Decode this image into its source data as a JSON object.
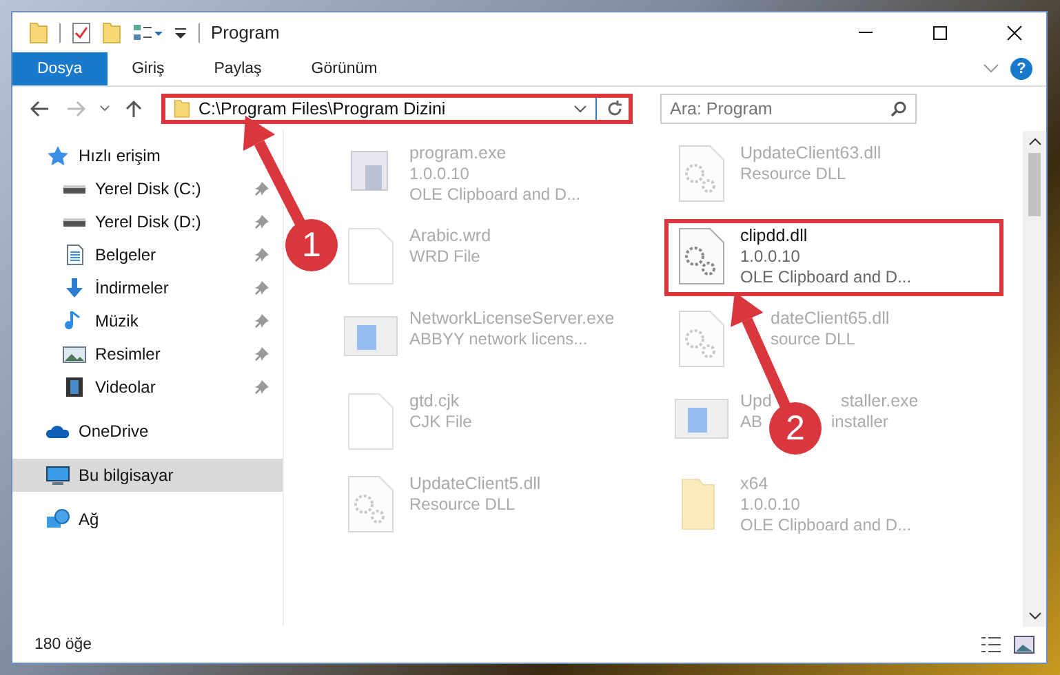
{
  "window": {
    "title": "Program"
  },
  "ribbon": {
    "tabs": [
      {
        "label": "Dosya",
        "selected": true
      },
      {
        "label": "Giriş",
        "selected": false
      },
      {
        "label": "Paylaş",
        "selected": false
      },
      {
        "label": "Görünüm",
        "selected": false
      }
    ],
    "help": "?"
  },
  "address": {
    "path": "C:\\Program Files\\Program Dizini",
    "marked": true
  },
  "search": {
    "placeholder": "Ara: Program"
  },
  "sidebar": {
    "items": [
      {
        "label": "Hızlı erişim",
        "kind": "star",
        "selected": false,
        "children": [
          {
            "label": "Yerel Disk (C:)",
            "kind": "drive",
            "pinned": true,
            "selected": false
          },
          {
            "label": "Yerel Disk (D:)",
            "kind": "drive",
            "pinned": true,
            "selected": false
          },
          {
            "label": "Belgeler",
            "kind": "document",
            "pinned": true,
            "selected": false
          },
          {
            "label": "İndirmeler",
            "kind": "download",
            "pinned": true,
            "selected": false
          },
          {
            "label": "Müzik",
            "kind": "music",
            "pinned": true,
            "selected": false
          },
          {
            "label": "Resimler",
            "kind": "picture",
            "pinned": true,
            "selected": false
          },
          {
            "label": "Videolar",
            "kind": "video",
            "pinned": true,
            "selected": false
          }
        ]
      },
      {
        "label": "OneDrive",
        "kind": "cloud",
        "selected": false
      },
      {
        "label": "Bu bilgisayar",
        "kind": "computer",
        "selected": true
      },
      {
        "label": "Ağ",
        "kind": "network",
        "selected": false
      }
    ]
  },
  "files": [
    {
      "name": "program.exe",
      "details": [
        "1.0.0.10",
        "OLE Clipboard and D..."
      ],
      "kind": "exe",
      "faded": true,
      "marked": false
    },
    {
      "name": "Arabic.wrd",
      "details": [
        "WRD File"
      ],
      "kind": "blank",
      "faded": true,
      "marked": false
    },
    {
      "name": "NetworkLicenseServer.exe",
      "details": [
        "ABBYY network licens..."
      ],
      "kind": "app",
      "faded": true,
      "marked": false
    },
    {
      "name": "gtd.cjk",
      "details": [
        "CJK File"
      ],
      "kind": "blank",
      "faded": true,
      "marked": false
    },
    {
      "name": "UpdateClient5.dll",
      "details": [
        "Resource DLL"
      ],
      "kind": "dll",
      "faded": true,
      "marked": false
    },
    {
      "name": "UpdateClient63.dll",
      "details": [
        "Resource DLL"
      ],
      "kind": "dll",
      "faded": true,
      "marked": false
    },
    {
      "name": "clipdd.dll",
      "details": [
        "1.0.0.10",
        "OLE Clipboard and D..."
      ],
      "kind": "dll",
      "faded": false,
      "marked": true
    },
    {
      "name": "dateClient65.dll",
      "details": [
        "source DLL"
      ],
      "kind": "dll",
      "faded": true,
      "marked": false,
      "covered": true
    },
    {
      "name": "Upd",
      "name_rest": "staller.exe",
      "details": [
        "AB"
      ],
      "details_rest": [
        "installer"
      ],
      "kind": "app",
      "faded": true,
      "marked": false
    },
    {
      "name": "x64",
      "details": [
        "1.0.0.10",
        "OLE Clipboard and D..."
      ],
      "kind": "folder",
      "faded": true,
      "marked": false
    }
  ],
  "status_bar": {
    "count": "180 öğe"
  },
  "annotations": [
    {
      "number": "1"
    },
    {
      "number": "2"
    }
  ]
}
